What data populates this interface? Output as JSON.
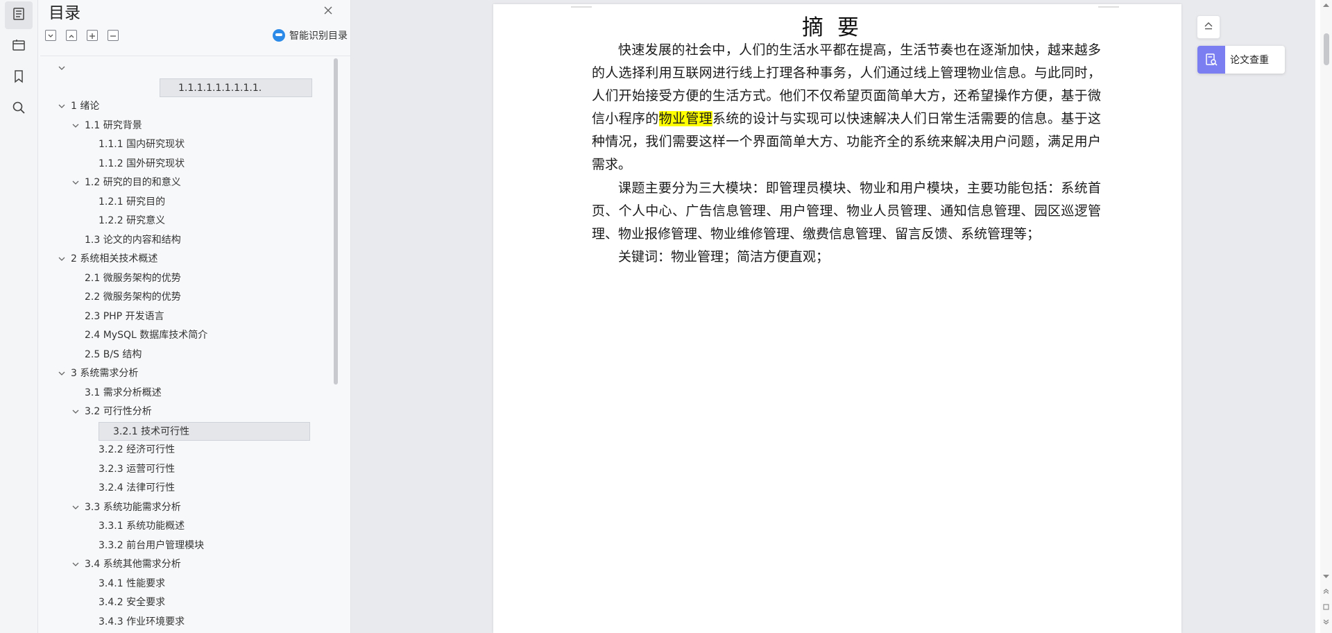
{
  "toc_panel": {
    "title": "目录",
    "ai_button_label": "智能识别目录"
  },
  "toc_items": [
    {
      "label": "",
      "level": 0,
      "caret": true
    },
    {
      "label": "1.1.1.1.1.1.1.1.1.",
      "level": 3,
      "caret": false,
      "heading": true
    },
    {
      "label": "1 绪论",
      "level": 0,
      "caret": true
    },
    {
      "label": "1.1  研究背景",
      "level": 1,
      "caret": true
    },
    {
      "label": "1.1.1 国内研究现状",
      "level": 2,
      "caret": false
    },
    {
      "label": "1.1.2 国外研究现状",
      "level": 2,
      "caret": false
    },
    {
      "label": "1.2 研究的目的和意义",
      "level": 1,
      "caret": true
    },
    {
      "label": "1.2.1 研究目的",
      "level": 2,
      "caret": false
    },
    {
      "label": "1.2.2  研究意义",
      "level": 2,
      "caret": false
    },
    {
      "label": "1.3  论文的内容和结构",
      "level": 1,
      "caret": false
    },
    {
      "label": "2 系统相关技术概述",
      "level": 0,
      "caret": true
    },
    {
      "label": "2.1  微服务架构的优势",
      "level": 1,
      "caret": false
    },
    {
      "label": "2.2 微服务架构的优势",
      "level": 1,
      "caret": false
    },
    {
      "label": "2.3 PHP 开发语言",
      "level": 1,
      "caret": false
    },
    {
      "label": "2.4 MySQL 数据库技术简介",
      "level": 1,
      "caret": false
    },
    {
      "label": "2.5 B/S 结构",
      "level": 1,
      "caret": false
    },
    {
      "label": "3 系统需求分析",
      "level": 0,
      "caret": true
    },
    {
      "label": "3.1 需求分析概述",
      "level": 1,
      "caret": false
    },
    {
      "label": "3.2 可行性分析",
      "level": 1,
      "caret": true
    },
    {
      "label": "3.2.1 技术可行性",
      "level": 2,
      "caret": false,
      "selected": true
    },
    {
      "label": "3.2.2 经济可行性",
      "level": 2,
      "caret": false
    },
    {
      "label": "3.2.3 运营可行性",
      "level": 2,
      "caret": false
    },
    {
      "label": "3.2.4 法律可行性",
      "level": 2,
      "caret": false
    },
    {
      "label": "3.3 系统功能需求分析",
      "level": 1,
      "caret": true
    },
    {
      "label": "3.3.1 系统功能概述",
      "level": 2,
      "caret": false
    },
    {
      "label": "3.3.2 前台用户管理模块",
      "level": 2,
      "caret": false
    },
    {
      "label": "3.4 系统其他需求分析",
      "level": 1,
      "caret": true
    },
    {
      "label": "3.4.1 性能要求",
      "level": 2,
      "caret": false
    },
    {
      "label": "3.4.2 安全要求",
      "level": 2,
      "caret": false
    },
    {
      "label": "3.4.3 作业环境要求",
      "level": 2,
      "caret": false
    }
  ],
  "document": {
    "heading": "摘要",
    "para1_before": "快速发展的社会中，人们的生活水平都在提高，生活节奏也在逐渐加快，越来越多的人选择利用互联网进行线上打理各种事务，人们通过线上管理物业信息。与此同时，人们开始接受方便的生活方式。他们不仅希望页面简单大方，还希望操作方便，基于微信小程序的",
    "para1_highlight": "物业管理",
    "para1_after": "系统的设计与实现可以快速解决人们日常生活需要的信息。基于这种情况，我们需要这样一个界面简单大方、功能齐全的系统来解决用户问题，满足用户需求。",
    "para2": "课题主要分为三大模块：即管理员模块、物业和用户模块，主要功能包括：系统首页、个人中心、广告信息管理、用户管理、物业人员管理、通知信息管理、园区巡逻管理、物业报修管理、物业维修管理、缴费信息管理、留言反馈、系统管理等；",
    "para3": "关键词：物业管理；简洁方便直观；",
    "highlight_color": "#ffff00"
  },
  "right_panel": {
    "check_label": "论文查重",
    "accent_color": "#7b7ef0"
  }
}
